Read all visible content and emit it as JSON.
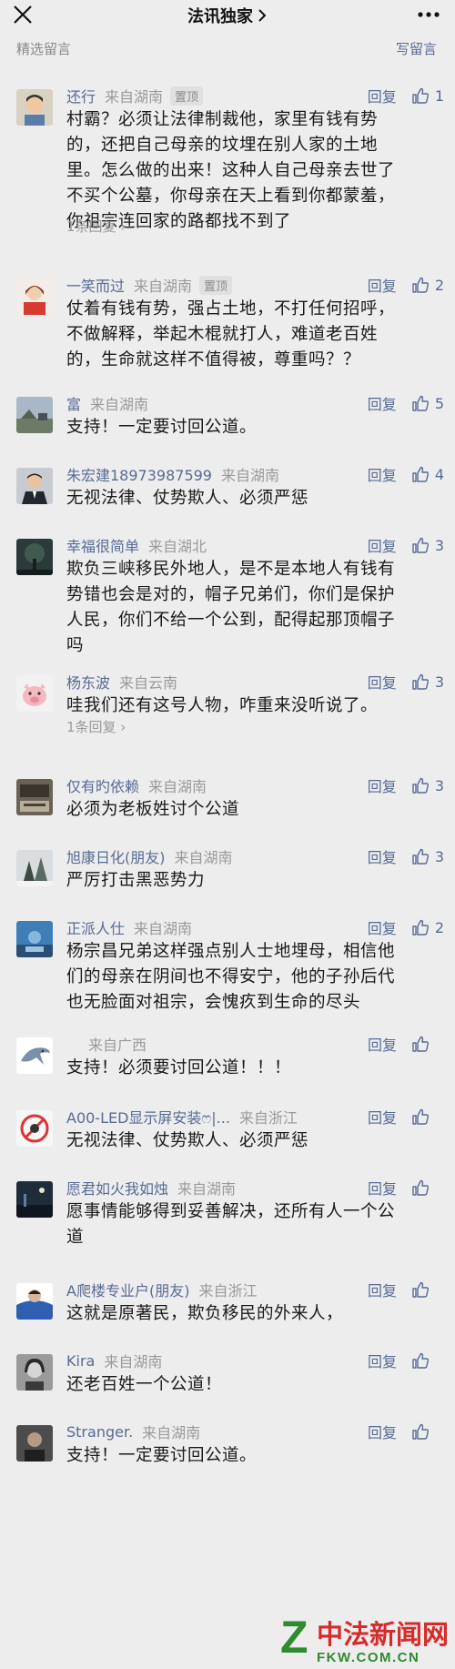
{
  "header": {
    "title": "法讯独家",
    "close_icon": "close-icon",
    "more_icon": "more-dots-icon"
  },
  "subheader": {
    "section_label": "精选留言",
    "write_label": "写留言"
  },
  "reply_label": "回复",
  "comments": [
    {
      "nickname": "还行",
      "location": "来自湖南",
      "tag": "置顶",
      "likes": "1",
      "lines": [
        "村霸？必须让法律制裁他，家里有钱有势",
        "的，还把自己母亲的坟埋在别人家的土地",
        "里。怎么做的出来！这种人自己母亲去世了",
        "不买个公墓，你母亲在天上看到你都蒙羞，",
        "你祖宗连回家的路都找不到了"
      ],
      "replies_link": "1条回复 ›"
    },
    {
      "nickname": "一笑而过",
      "location": "来自湖南",
      "tag": "置顶",
      "likes": "2",
      "lines": [
        "仗着有钱有势，强占土地，不打任何招呼，",
        "不做解释，举起木棍就打人，难道老百姓",
        "的，生命就这样不值得被，尊重吗？？"
      ]
    },
    {
      "nickname": "富",
      "location": "来自湖南",
      "likes": "5",
      "lines": [
        "支持！一定要讨回公道。"
      ]
    },
    {
      "nickname": "朱宏建18973987599",
      "location": "来自湖南",
      "likes": "4",
      "lines": [
        "无视法律、仗势欺人、必须严惩"
      ]
    },
    {
      "nickname": "幸福很简单",
      "location": "来自湖北",
      "likes": "3",
      "lines": [
        "欺负三峡移民外地人，是不是本地人有钱有",
        "势错也会是对的，帽子兄弟们，你们是保护",
        "人民，你们不给一个公到，配得起那顶帽子",
        "吗"
      ]
    },
    {
      "nickname": "杨东波",
      "location": "来自云南",
      "likes": "3",
      "lines": [
        "哇我们还有这号人物，咋重来没听说了。"
      ],
      "replies_link": "1条回复 ›"
    },
    {
      "nickname": "仅有旳依赖",
      "location": "来自湖南",
      "likes": "3",
      "lines": [
        "必须为老板姓讨个公道"
      ]
    },
    {
      "nickname": "旭康日化(朋友)",
      "location": "来自湖南",
      "likes": "3",
      "lines": [
        "严厉打击黑恶势力"
      ]
    },
    {
      "nickname": "正派人仕",
      "location": "来自湖南",
      "likes": "2",
      "lines": [
        "杨宗昌兄弟这样强点别人士地埋母，相信他",
        "们的母亲在阴间也不得安宁，他的子孙后代",
        "也无脸面对祖宗，会愧疚到生命的尽头"
      ]
    },
    {
      "nickname": "",
      "location": "来自广西",
      "likes": "",
      "lines": [
        "支持！必须要讨回公道！！！"
      ]
    },
    {
      "nickname": "A00-LED显示屏安装ෆ|...",
      "location": "来自浙江",
      "likes": "",
      "lines": [
        "无视法律、仗势欺人、必须严惩"
      ]
    },
    {
      "nickname": "愿君如火我如烛",
      "location": "来自湖南",
      "likes": "",
      "lines": [
        "愿事情能够得到妥善解决，还所有人一个公",
        "道"
      ]
    },
    {
      "nickname": "A爬楼专业户(朋友)",
      "location": "来自浙江",
      "likes": "",
      "lines": [
        "这就是原著民，欺负移民的外来人，"
      ]
    },
    {
      "nickname": "Kira",
      "location": "来自湖南",
      "likes": "",
      "lines": [
        "还老百姓一个公道！"
      ]
    },
    {
      "nickname": "Stranger.",
      "location": "来自湖南",
      "likes": "",
      "lines": [
        "支持！一定要讨回公道。"
      ]
    }
  ],
  "watermark": {
    "logo_letter": "Z",
    "name": "中法新闻网",
    "url": "FKW.COM.CN"
  },
  "colors": {
    "background": "#ededed",
    "link": "#576b95",
    "meta": "#9a9a9a",
    "text": "#1a1a1a",
    "watermark_green": "#2e8b2e",
    "watermark_red": "#d62b2b"
  }
}
